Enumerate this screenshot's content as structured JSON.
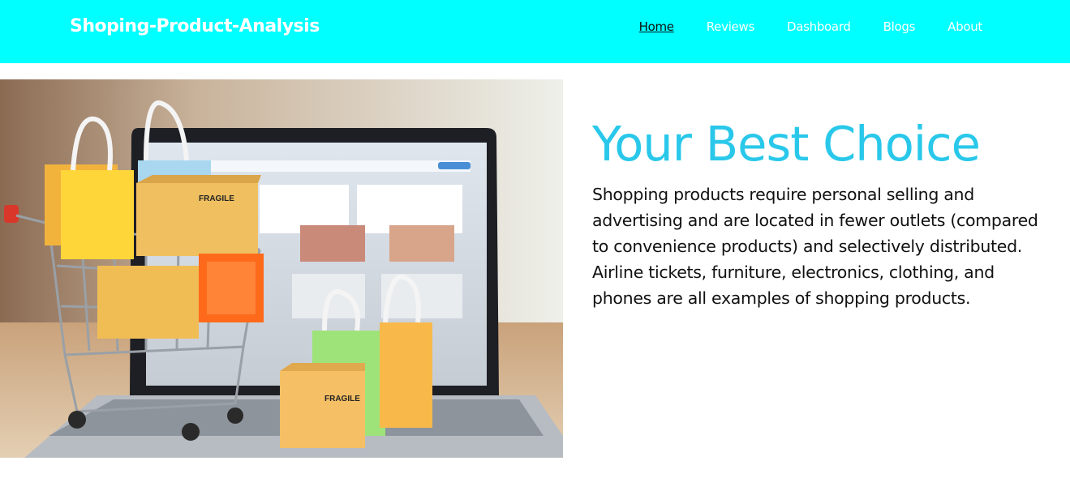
{
  "navbar": {
    "brand": "Shoping-Product-Analysis",
    "links": [
      {
        "label": "Home",
        "active": true
      },
      {
        "label": "Reviews",
        "active": false
      },
      {
        "label": "Dashboard",
        "active": false
      },
      {
        "label": "Blogs",
        "active": false
      },
      {
        "label": "About",
        "active": false
      }
    ]
  },
  "hero": {
    "title": "Your Best Choice",
    "description": "Shopping products require personal selling and advertising and are located in fewer outlets (compared to convenience products) and selectively distributed. Airline tickets, furniture, electronics, clothing, and phones are all examples of shopping products.",
    "image_box_label": "FRAGILE"
  },
  "colors": {
    "navbar_bg": "#00ffff",
    "title": "#29c8ea",
    "text": "#111111"
  }
}
